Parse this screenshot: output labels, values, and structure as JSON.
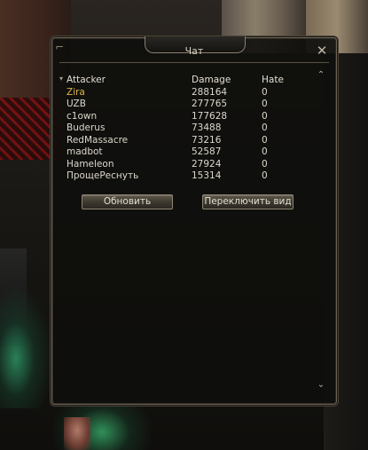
{
  "window": {
    "title": "Чат",
    "close_icon": "close-icon"
  },
  "table": {
    "headers": {
      "name": "Attacker",
      "damage": "Damage",
      "hate": "Hate"
    },
    "rows": [
      {
        "name": "Zira",
        "damage": "288164",
        "hate": "0",
        "highlight": true
      },
      {
        "name": "UZB",
        "damage": "277765",
        "hate": "0"
      },
      {
        "name": "c1own",
        "damage": "177628",
        "hate": "0"
      },
      {
        "name": "Buderus",
        "damage": "73488",
        "hate": "0"
      },
      {
        "name": "RedMassacre",
        "damage": "73216",
        "hate": "0"
      },
      {
        "name": "madbot",
        "damage": "52587",
        "hate": "0"
      },
      {
        "name": "Hameleon",
        "damage": "27924",
        "hate": "0"
      },
      {
        "name": "ПрощеРеснуть",
        "damage": "15314",
        "hate": "0"
      }
    ]
  },
  "buttons": {
    "refresh": "Обновить",
    "toggle_view": "Переключить вид"
  },
  "colors": {
    "highlight_name": "#e0b64a",
    "text": "#ddd8cc",
    "window_border": "#6b6354"
  }
}
